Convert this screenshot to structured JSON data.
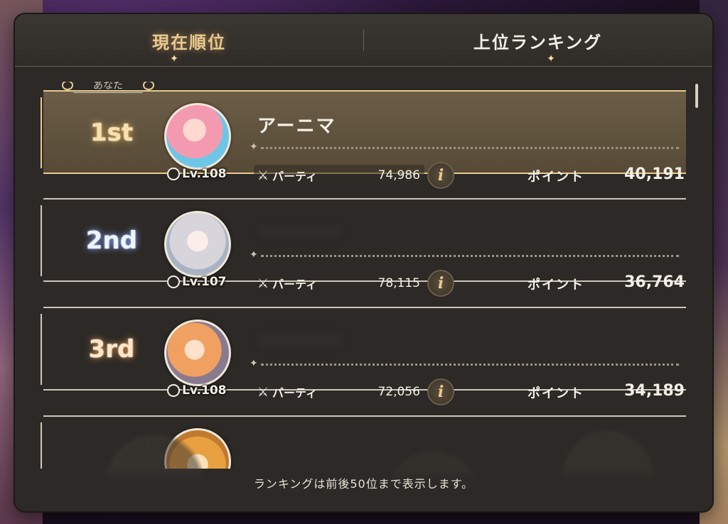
{
  "tabs": [
    {
      "label": "現在順位",
      "active": true
    },
    {
      "label": "上位ランキング",
      "active": false
    }
  ],
  "you_tag": "あなた",
  "entries": [
    {
      "rank": "1st",
      "name": "アーニマ",
      "level": "Lv.108",
      "party_label": "パーティ",
      "party_value": "74,986",
      "points_label": "ポイント",
      "points": "40,191",
      "is_you": true
    },
    {
      "rank": "2nd",
      "name": "",
      "level": "Lv.107",
      "party_label": "パーティ",
      "party_value": "78,115",
      "points_label": "ポイント",
      "points": "36,764",
      "is_you": false
    },
    {
      "rank": "3rd",
      "name": "",
      "level": "Lv.108",
      "party_label": "パーティ",
      "party_value": "72,056",
      "points_label": "ポイント",
      "points": "34,189",
      "is_you": false
    },
    {
      "rank": "",
      "name": "",
      "level": "",
      "party_label": "",
      "party_value": "",
      "points_label": "",
      "points": "",
      "is_you": false
    }
  ],
  "info_symbol": "i",
  "footer_note": "ランキングは前後50位まで表示します。",
  "colors": {
    "accent_gold": "#e9c98f",
    "panel": "#2c2926",
    "highlight_row": "#6b5d46"
  }
}
